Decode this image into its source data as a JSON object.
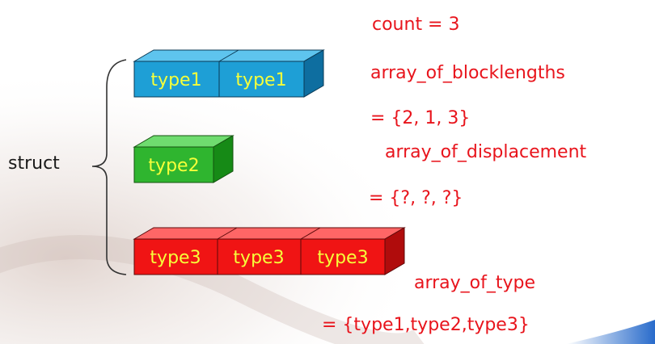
{
  "struct_label": "struct",
  "blocks": {
    "row1": [
      "type1",
      "type1"
    ],
    "row2": [
      "type2"
    ],
    "row3": [
      "type3",
      "type3",
      "type3"
    ]
  },
  "colors": {
    "type1": "#1e9fd6",
    "type2": "#2fb52f",
    "type3": "#f01414",
    "label_text": "#f6ff3a",
    "notes": "#e8141c"
  },
  "notes": {
    "count": "count = 3",
    "blocklengths_label": "array_of_blocklengths",
    "blocklengths_value": "= {2, 1, 3}",
    "displacement_label": "array_of_displacement",
    "displacement_value": "= {?, ?, ?}",
    "type_label": "array_of_type",
    "type_value": "= {type1,type2,type3}"
  }
}
